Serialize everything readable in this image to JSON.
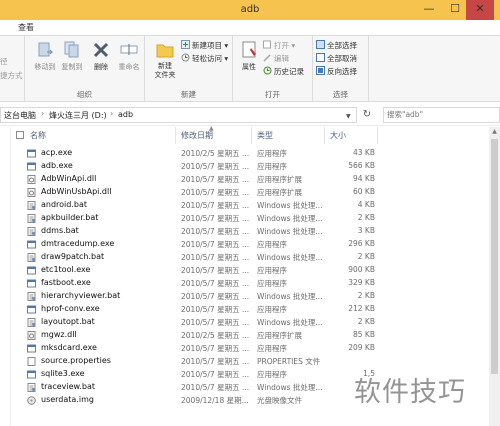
{
  "window": {
    "title": "adb",
    "minimize": "—",
    "maximize": "☐",
    "close": "✕"
  },
  "ribbon_tab": "查看",
  "ribbon": {
    "clipboard_partial": {
      "line1": "径",
      "line2": "捷方式"
    },
    "organize": {
      "label": "组织",
      "move_to": "移动到",
      "copy_to": "复制到",
      "delete": "删除",
      "rename": "重命名"
    },
    "new": {
      "label": "新建",
      "new_folder": "新建\n文件夹",
      "new_item": "新建项目 ▾",
      "easy_access": "轻松访问 ▾"
    },
    "open": {
      "label": "打开",
      "properties": "属性",
      "open": "打开 ▾",
      "edit": "编辑",
      "history": "历史记录"
    },
    "select": {
      "label": "选择",
      "select_all": "全部选择",
      "select_none": "全部取消",
      "invert": "反向选择"
    }
  },
  "address": {
    "crumbs": [
      "这台电脑",
      "烽火连三月 (D:)",
      "adb"
    ],
    "search_placeholder": "搜索\"adb\""
  },
  "columns": {
    "name": "名称",
    "date": "修改日期",
    "type": "类型",
    "size": "大小"
  },
  "files": [
    {
      "name": "acp.exe",
      "date": "2010/2/5 星期五 ...",
      "type": "应用程序",
      "size": "43 KB",
      "icon": "exe-icon"
    },
    {
      "name": "adb.exe",
      "date": "2010/5/7 星期五 ...",
      "type": "应用程序",
      "size": "566 KB",
      "icon": "exe-icon"
    },
    {
      "name": "AdbWinApi.dll",
      "date": "2010/5/7 星期五 ...",
      "type": "应用程序扩展",
      "size": "94 KB",
      "icon": "dll-icon"
    },
    {
      "name": "AdbWinUsbApi.dll",
      "date": "2010/5/7 星期五 ...",
      "type": "应用程序扩展",
      "size": "60 KB",
      "icon": "dll-icon"
    },
    {
      "name": "android.bat",
      "date": "2010/5/7 星期五 ...",
      "type": "Windows 批处理...",
      "size": "4 KB",
      "icon": "bat-icon"
    },
    {
      "name": "apkbuilder.bat",
      "date": "2010/5/7 星期五 ...",
      "type": "Windows 批处理...",
      "size": "2 KB",
      "icon": "bat-icon"
    },
    {
      "name": "ddms.bat",
      "date": "2010/5/7 星期五 ...",
      "type": "Windows 批处理...",
      "size": "3 KB",
      "icon": "bat-icon"
    },
    {
      "name": "dmtracedump.exe",
      "date": "2010/5/7 星期五 ...",
      "type": "应用程序",
      "size": "296 KB",
      "icon": "exe-icon"
    },
    {
      "name": "draw9patch.bat",
      "date": "2010/5/7 星期五 ...",
      "type": "Windows 批处理...",
      "size": "2 KB",
      "icon": "bat-icon"
    },
    {
      "name": "etc1tool.exe",
      "date": "2010/5/7 星期五 ...",
      "type": "应用程序",
      "size": "900 KB",
      "icon": "exe-icon"
    },
    {
      "name": "fastboot.exe",
      "date": "2010/5/7 星期五 ...",
      "type": "应用程序",
      "size": "329 KB",
      "icon": "exe-icon"
    },
    {
      "name": "hierarchyviewer.bat",
      "date": "2010/5/7 星期五 ...",
      "type": "Windows 批处理...",
      "size": "2 KB",
      "icon": "bat-icon"
    },
    {
      "name": "hprof-conv.exe",
      "date": "2010/5/7 星期五 ...",
      "type": "应用程序",
      "size": "212 KB",
      "icon": "exe-icon"
    },
    {
      "name": "layoutopt.bat",
      "date": "2010/5/7 星期五 ...",
      "type": "Windows 批处理...",
      "size": "2 KB",
      "icon": "bat-icon"
    },
    {
      "name": "mgwz.dll",
      "date": "2010/2/5 星期五 ...",
      "type": "应用程序扩展",
      "size": "85 KB",
      "icon": "dll-icon"
    },
    {
      "name": "mksdcard.exe",
      "date": "2010/5/7 星期五 ...",
      "type": "应用程序",
      "size": "209 KB",
      "icon": "exe-icon"
    },
    {
      "name": "source.properties",
      "date": "2010/5/7 星期五 ...",
      "type": "PROPERTIES 文件",
      "size": "",
      "icon": "file-icon"
    },
    {
      "name": "sqlite3.exe",
      "date": "2010/5/7 星期五 ...",
      "type": "应用程序",
      "size": "1,5",
      "icon": "exe-icon"
    },
    {
      "name": "traceview.bat",
      "date": "2010/5/7 星期五 ...",
      "type": "Windows 批处理...",
      "size": "",
      "icon": "bat-icon"
    },
    {
      "name": "userdata.img",
      "date": "2009/12/18 星期...",
      "type": "光盘映像文件",
      "size": "",
      "icon": "img-icon"
    }
  ],
  "watermark": "软件技巧",
  "colors": {
    "titlebar": "#f5c34e",
    "close": "#c74646",
    "header_text": "#4c607a"
  }
}
